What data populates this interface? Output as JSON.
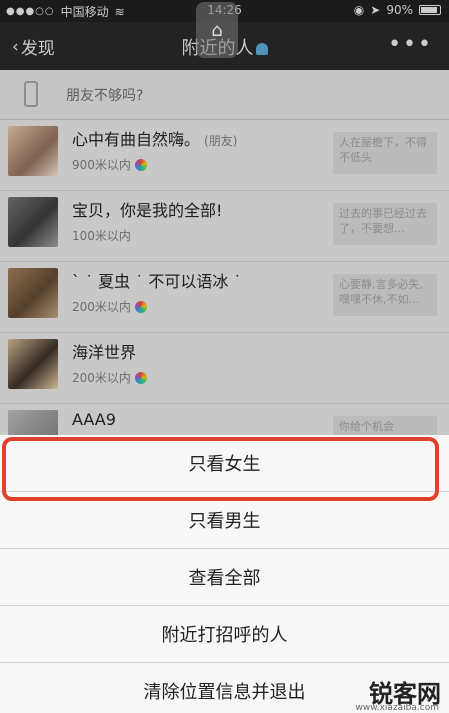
{
  "status_bar": {
    "carrier": "中国移动",
    "time": "14:26",
    "battery": "90%",
    "battery_level": 0.9
  },
  "nav": {
    "back_label": "发现",
    "title": "附近的人",
    "more_label": "•••"
  },
  "tip": {
    "text": "朋友不够吗?"
  },
  "people": [
    {
      "name": "心中有曲自然嗨。",
      "tag": "(朋友)",
      "distance": "900米以内",
      "signature": "人在屋檐下，不得不低头"
    },
    {
      "name": "宝贝，你是我的全部!",
      "tag": "",
      "distance": "100米以内",
      "signature": "过去的事已经过去了，不要想…"
    },
    {
      "name": "` ˙ 夏虫 ˙ 不可以语冰 ˙ ",
      "tag": "",
      "distance": "200米以内",
      "signature": "心要静,言多必失,嘿嘿不休,不如…"
    },
    {
      "name": "海洋世界",
      "tag": "",
      "distance": "200米以内",
      "signature": ""
    },
    {
      "name": "AAA9",
      "tag": "",
      "distance": "",
      "signature": "你给个机会"
    }
  ],
  "action_sheet": {
    "items": [
      "只看女生",
      "只看男生",
      "查看全部",
      "附近打招呼的人",
      "清除位置信息并退出"
    ]
  },
  "watermark": {
    "text": "锐客网",
    "sub": "www.xiazaiba.com"
  },
  "colors": {
    "highlight": "#e0412a",
    "nav_bg": "#262626"
  }
}
